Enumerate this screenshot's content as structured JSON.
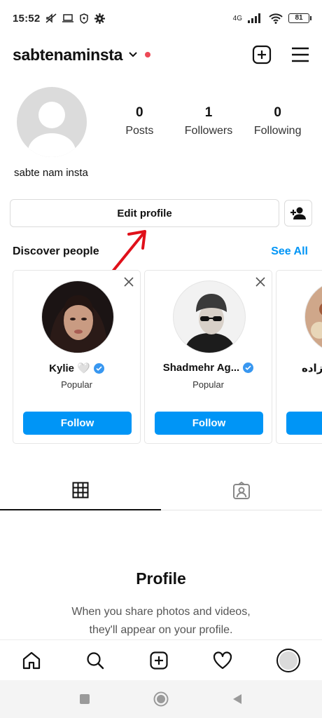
{
  "status_bar": {
    "time": "15:52",
    "battery": "81",
    "network": "4G"
  },
  "header": {
    "username": "sabtenaminsta"
  },
  "profile": {
    "full_name": "sabte nam insta",
    "stats": [
      {
        "value": "0",
        "label": "Posts"
      },
      {
        "value": "1",
        "label": "Followers"
      },
      {
        "value": "0",
        "label": "Following"
      }
    ],
    "edit_label": "Edit profile"
  },
  "discover": {
    "title": "Discover people",
    "see_all": "See All",
    "cards": [
      {
        "name": "Kylie 🤍",
        "subtitle": "Popular",
        "button": "Follow"
      },
      {
        "name": "Shadmehr Ag...",
        "subtitle": "Popular",
        "button": "Follow"
      },
      {
        "name": "زاده"
      }
    ]
  },
  "empty_state": {
    "title": "Profile",
    "line1": "When you share photos and videos,",
    "line2": "they'll appear on your profile."
  },
  "icons": {
    "header_actions": [
      "new-post-icon",
      "menu-icon"
    ],
    "tabs": [
      "grid-icon",
      "tagged-icon"
    ],
    "bottom_nav": [
      "home-icon",
      "search-icon",
      "create-icon",
      "activity-icon",
      "profile-avatar"
    ],
    "system_nav": [
      "recents-icon",
      "home-circle-icon",
      "back-icon"
    ]
  },
  "colors": {
    "accent": "#0095f6",
    "notification_dot": "#ed4956",
    "annotation_arrow": "#e0101a"
  }
}
